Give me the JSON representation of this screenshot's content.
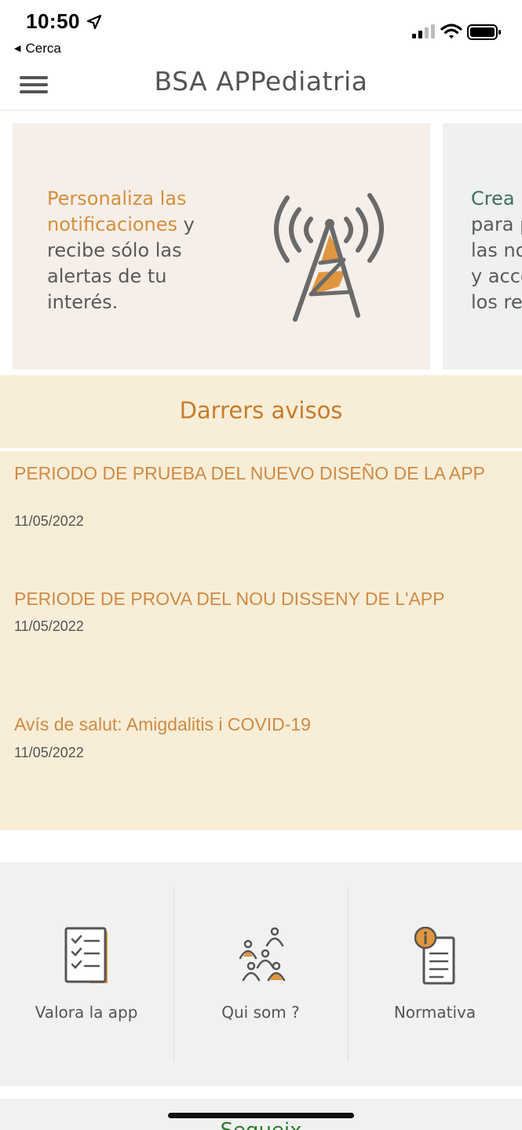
{
  "status_bar": {
    "time": "10:50",
    "back_label": "Cerca"
  },
  "header": {
    "title": "BSA APPediatria"
  },
  "carousel": [
    {
      "highlight": "Personaliza las notificaciones",
      "body": "y recibe sólo las alertas de tu interés.",
      "icon": "antenna-icon"
    },
    {
      "highlight": "Crea u",
      "lines": [
        "para p",
        "las no",
        "y acce",
        "los re"
      ]
    }
  ],
  "notices": {
    "title": "Darrers avisos",
    "items": [
      {
        "title": "PERIODO DE PRUEBA  DEL NUEVO DISEÑO DE LA APP",
        "date": "11/05/2022"
      },
      {
        "title": "PERIODE DE PROVA DEL NOU DISSENY DE L'APP",
        "date": "11/05/2022"
      },
      {
        "title": "Avís de salut: Amigdalitis i COVID-19",
        "date": "11/05/2022"
      }
    ]
  },
  "shortcuts": [
    {
      "label": "Valora la app",
      "icon": "checklist-icon"
    },
    {
      "label": "Qui som ?",
      "icon": "people-icon"
    },
    {
      "label": "Normativa",
      "icon": "info-document-icon"
    }
  ],
  "bottom": {
    "text": "Segueix"
  },
  "colors": {
    "accent": "#d78f3b",
    "notices_bg": "#f8eed7",
    "title": "#c97c2c"
  }
}
